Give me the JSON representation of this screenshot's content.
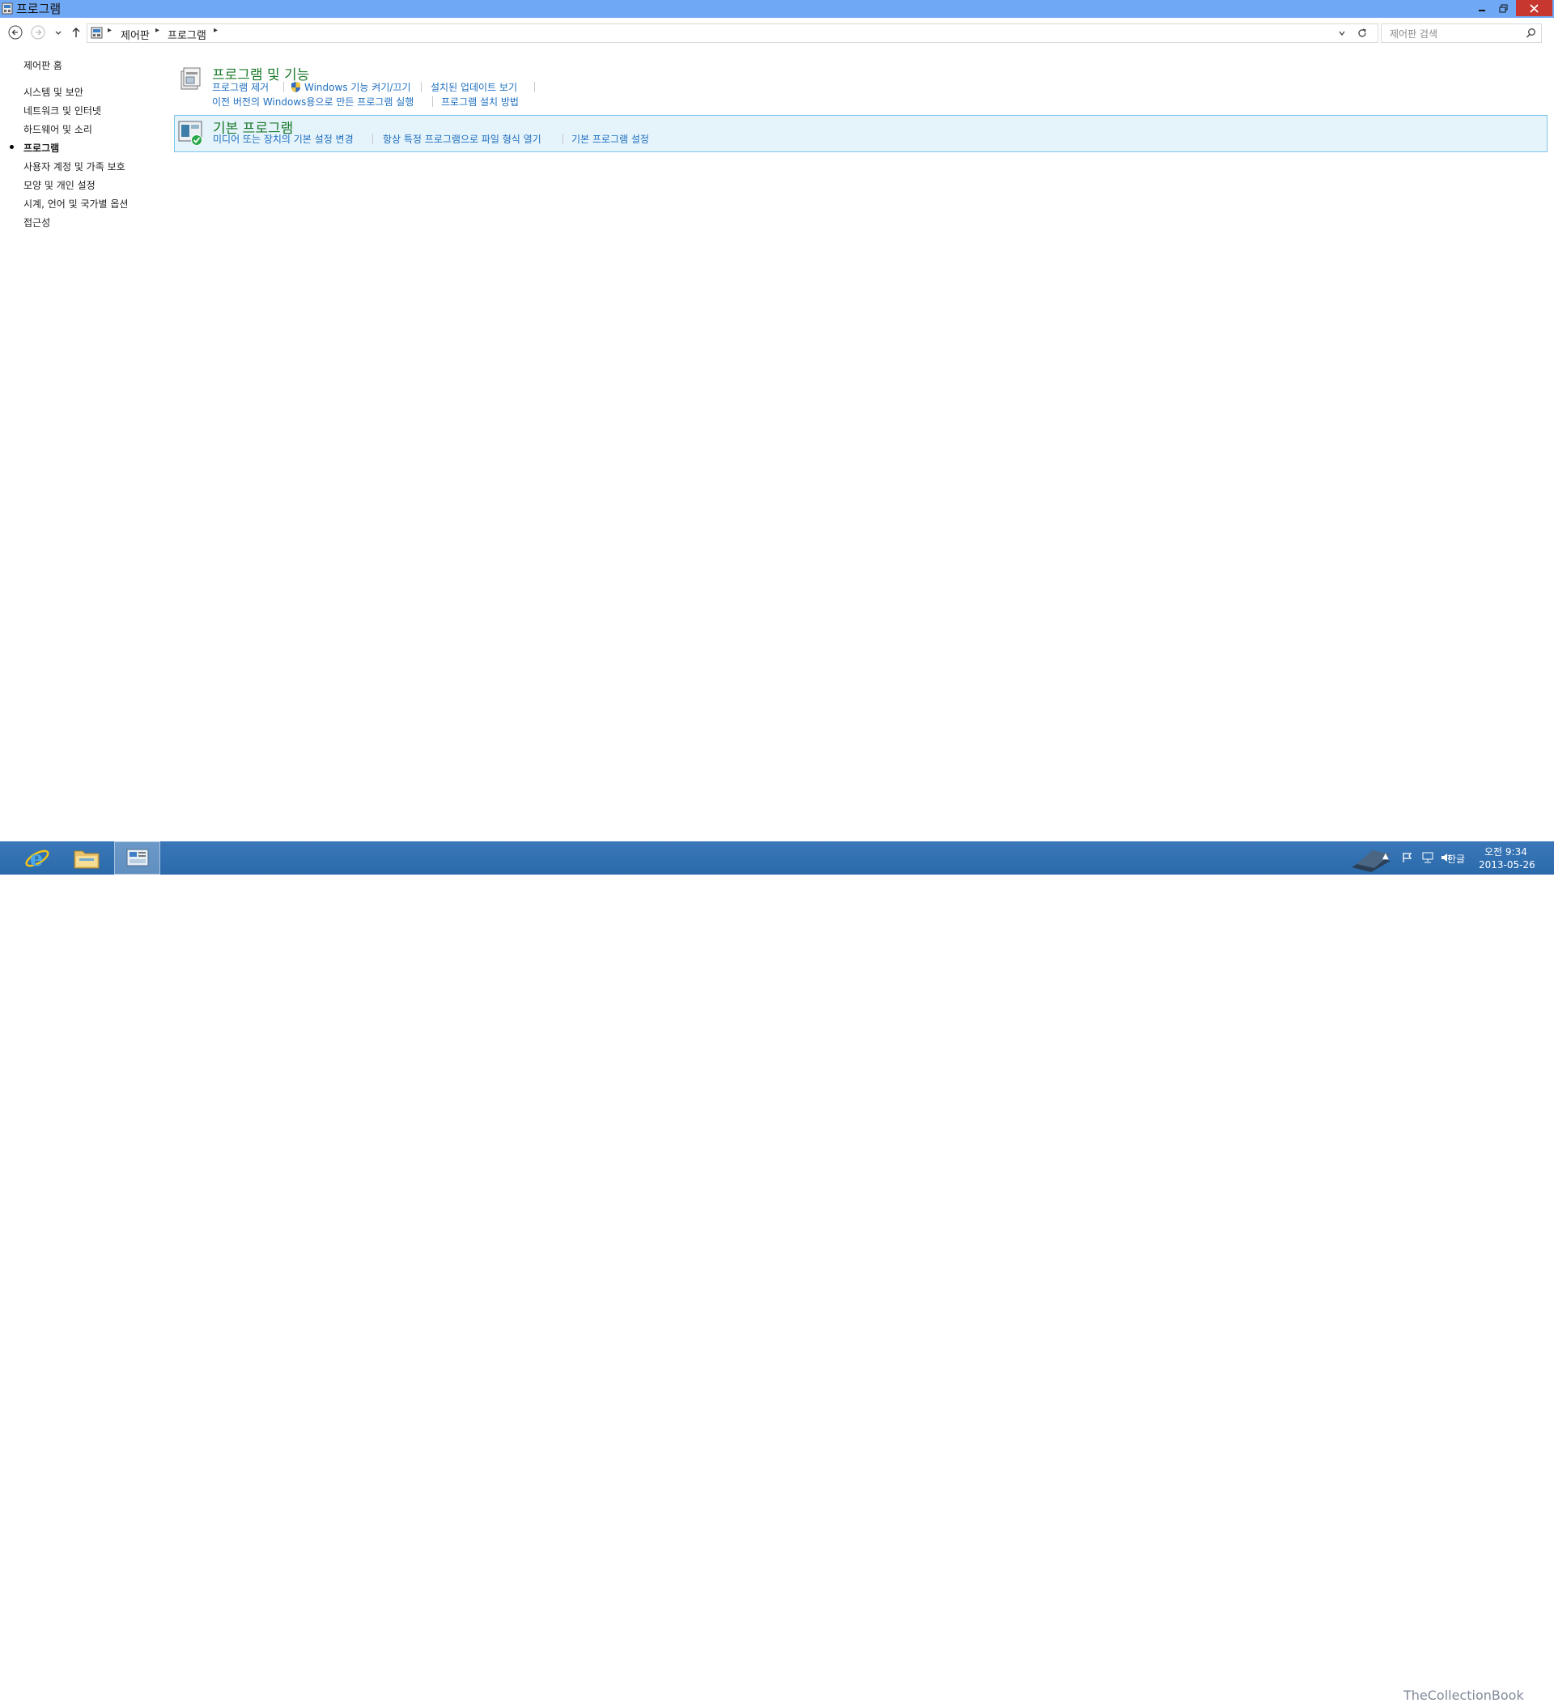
{
  "window": {
    "title": "프로그램"
  },
  "address": {
    "breadcrumbs": [
      "제어판",
      "프로그램"
    ],
    "search_placeholder": "제어판 검색"
  },
  "sidebar": {
    "home": "제어판 홈",
    "items": [
      "시스템 및 보안",
      "네트워크 및 인터넷",
      "하드웨어 및 소리",
      "프로그램",
      "사용자 계정 및 가족 보호",
      "모양 및 개인 설정",
      "시계, 언어 및 국가별 옵션",
      "접근성"
    ],
    "current_index": 3
  },
  "categories": [
    {
      "title": "프로그램 및 기능",
      "row1": [
        "프로그램 제거",
        "Windows 기능 켜기/끄기",
        "설치된 업데이트 보기"
      ],
      "row2": [
        "이전 버전의 Windows용으로 만든 프로그램 실행",
        "프로그램 설치 방법"
      ],
      "icon": "programs-features-icon"
    },
    {
      "title": "기본 프로그램",
      "row1": [
        "미디어 또는 장치의 기본 설정 변경",
        "항상 특정 프로그램으로 파일 형식 열기",
        "기본 프로그램 설정"
      ],
      "icon": "default-programs-icon",
      "selected": true
    }
  ],
  "taskbar": {
    "apps": [
      "internet-explorer-icon",
      "file-explorer-icon",
      "control-panel-icon"
    ],
    "ime": "한글",
    "time": "오전 9:34",
    "date": "2013-05-26",
    "watermark": "TheCollectionBook"
  },
  "colors": {
    "title_bar": "#6fa8f5",
    "link": "#1f6fbf",
    "heading": "#1c7a2a",
    "selection": "#e5f3fb",
    "taskbar": "#2f6fb0"
  }
}
